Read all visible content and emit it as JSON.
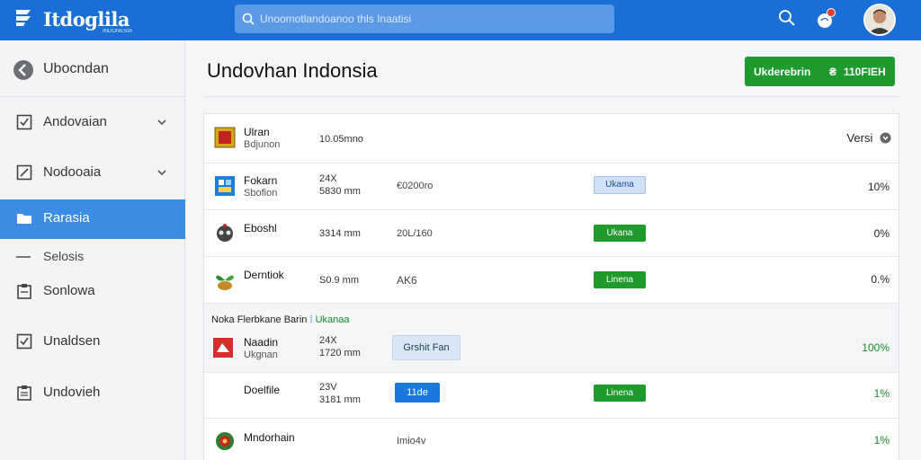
{
  "app": {
    "logo_text": "Itdoglila",
    "logo_sub": "INDONESIA"
  },
  "search": {
    "placeholder": "Unoomotlandoanoo thls Inaatisi"
  },
  "sidebar": {
    "back_label": "Ubocndan",
    "items": [
      {
        "label": "Andovaian",
        "icon": "checkbox-icon",
        "has_chevron": true
      },
      {
        "label": "Nodooaia",
        "icon": "edit-icon",
        "has_chevron": true
      },
      {
        "label": "Rarasia",
        "icon": "folder-icon",
        "active": true
      },
      {
        "label": "Selosis",
        "sub": true
      },
      {
        "label": "Sonlowa",
        "icon": "clipboard-icon"
      },
      {
        "label": "Unaldsen",
        "icon": "checklist-icon"
      },
      {
        "label": "Undovieh",
        "icon": "document-icon"
      }
    ]
  },
  "main": {
    "title": "Undovhan Indonsia",
    "primary_button": {
      "left": "Ukderebrin",
      "separator": "₴",
      "right": "110FIEH"
    }
  },
  "table": {
    "header": {
      "name": "Ulran",
      "sub": "Bdjunon",
      "c1": "10.05mno",
      "version": "Versi"
    },
    "rows": [
      {
        "name": "Fokarn",
        "sub": "Sbofion",
        "c1": "24X",
        "c1b": "5830 mm",
        "c2": "€0200ro",
        "badge": "Ukama",
        "badge_style": "outline",
        "pct": "10%"
      },
      {
        "name": "Eboshl",
        "sub": "",
        "c1": "3314 mm",
        "c2": "20L/160",
        "badge": "Ukana",
        "badge_style": "green",
        "pct": "0%"
      },
      {
        "name": "Derntiok",
        "sub": "",
        "c1": "S0.9 mm",
        "c2": "AK6",
        "badge": "Linena",
        "badge_style": "green",
        "pct": "0.%"
      },
      {
        "name": "Naadin",
        "sub": "Ukgnan",
        "c1": "24X",
        "c1b": "1720 mm",
        "c2_button": "Grshit Fan",
        "pct": "100%"
      },
      {
        "name": "Doelfile",
        "sub": "",
        "c1": "23V",
        "c1b": "3181 mm",
        "c2_button": "11de",
        "badge": "Linena",
        "badge_style": "green",
        "pct": "1%"
      },
      {
        "name": "Mndorhain",
        "sub": "",
        "c1": "",
        "c2": "Imio4v",
        "pct": "1%"
      }
    ],
    "group_label": {
      "text": "Noka Flerbkane Barin",
      "separator": "⁞",
      "link": "Ukanaa"
    }
  },
  "colors": {
    "topbar": "#1a6fd6",
    "accent_green": "#1f9a2c",
    "sidebar_active": "#3d8ce6"
  }
}
